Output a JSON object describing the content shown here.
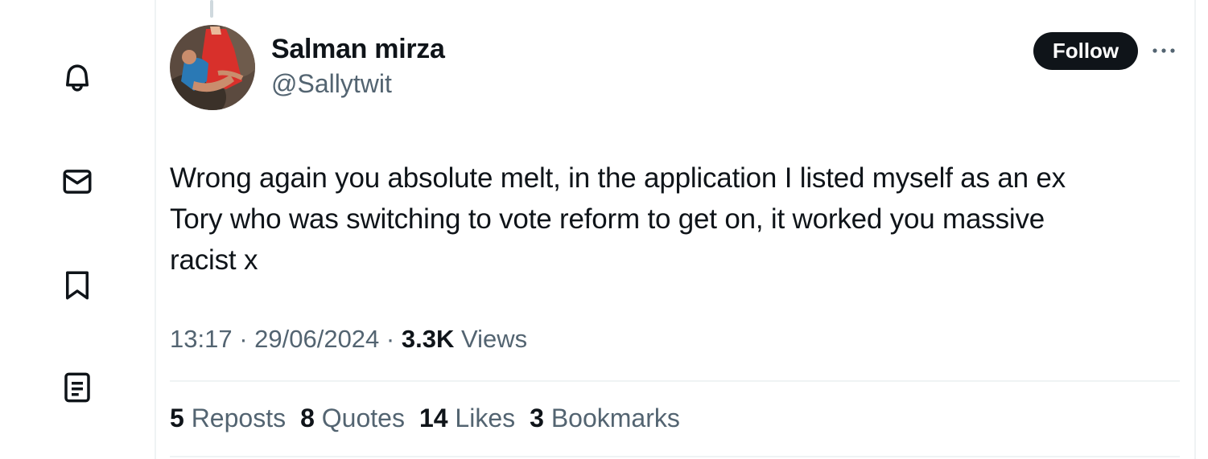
{
  "colors": {
    "text_primary": "#0f1419",
    "text_secondary": "#536471",
    "follow_bg": "#0f1419",
    "border": "#eff3f4"
  },
  "nav": {
    "items": [
      {
        "icon": "bell-icon",
        "label": "Notifications"
      },
      {
        "icon": "envelope-icon",
        "label": "Messages"
      },
      {
        "icon": "bookmark-icon",
        "label": "Bookmarks"
      },
      {
        "icon": "list-icon",
        "label": "Lists"
      }
    ]
  },
  "tweet": {
    "author": {
      "display_name": "Salman mirza",
      "handle": "@Sallytwit"
    },
    "follow_label": "Follow",
    "more_icon": "more-dots-icon",
    "text": "Wrong again you absolute melt, in the application I listed myself as an ex\nTory who was switching to vote reform to get on, it worked you massive\nracist x",
    "time": "13:17",
    "date": "29/06/2024",
    "views_count": "3.3K",
    "views_label": "Views",
    "stats": [
      {
        "count": "5",
        "label": "Reposts"
      },
      {
        "count": "8",
        "label": "Quotes"
      },
      {
        "count": "14",
        "label": "Likes"
      },
      {
        "count": "3",
        "label": "Bookmarks"
      }
    ]
  }
}
